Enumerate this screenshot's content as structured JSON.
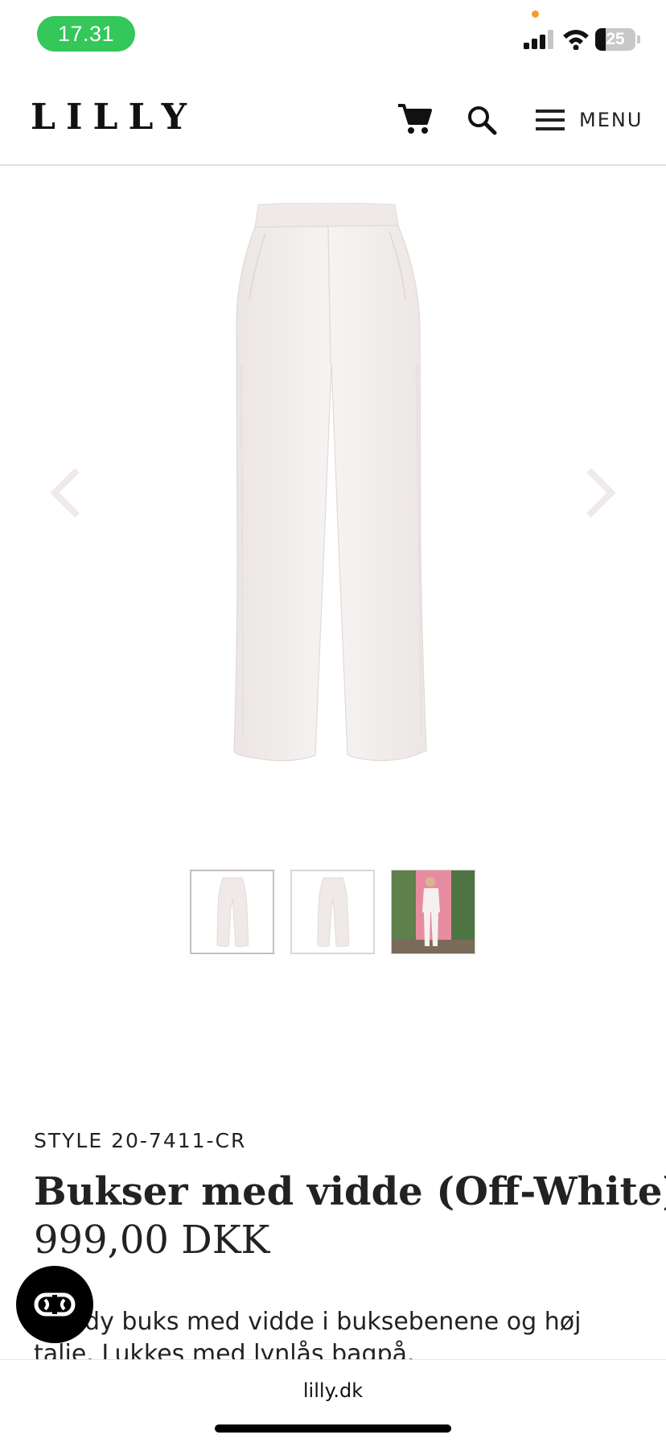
{
  "status_bar": {
    "time": "17.31",
    "battery_level": "25",
    "battery_fraction": 0.25,
    "icons": [
      "signal-icon",
      "wifi-icon",
      "battery-icon"
    ],
    "colors": {
      "time_pill": "#34c759",
      "privacy_dot": "#f39c2c"
    }
  },
  "header": {
    "logo": "LILLY",
    "icons": [
      "cart-icon",
      "search-icon",
      "menu-icon"
    ],
    "menu_label": "MENU"
  },
  "gallery": {
    "arrows": [
      "chevron-left-icon",
      "chevron-right-icon"
    ],
    "thumbnails": [
      {
        "kind": "product-front",
        "active": true
      },
      {
        "kind": "product-back",
        "active": false
      },
      {
        "kind": "model-photo",
        "active": false
      }
    ]
  },
  "product": {
    "style_code": "STYLE 20-7411-CR",
    "title": "Bukser med vidde (Off-White)",
    "price": "999,00 DKK",
    "description": "Trendy buks med vidde i buksebenene og høj talje. Lukkes med lynlås bagpå."
  },
  "chat": {
    "icon": "chat-icon"
  },
  "browser": {
    "url": "lilly.dk"
  }
}
